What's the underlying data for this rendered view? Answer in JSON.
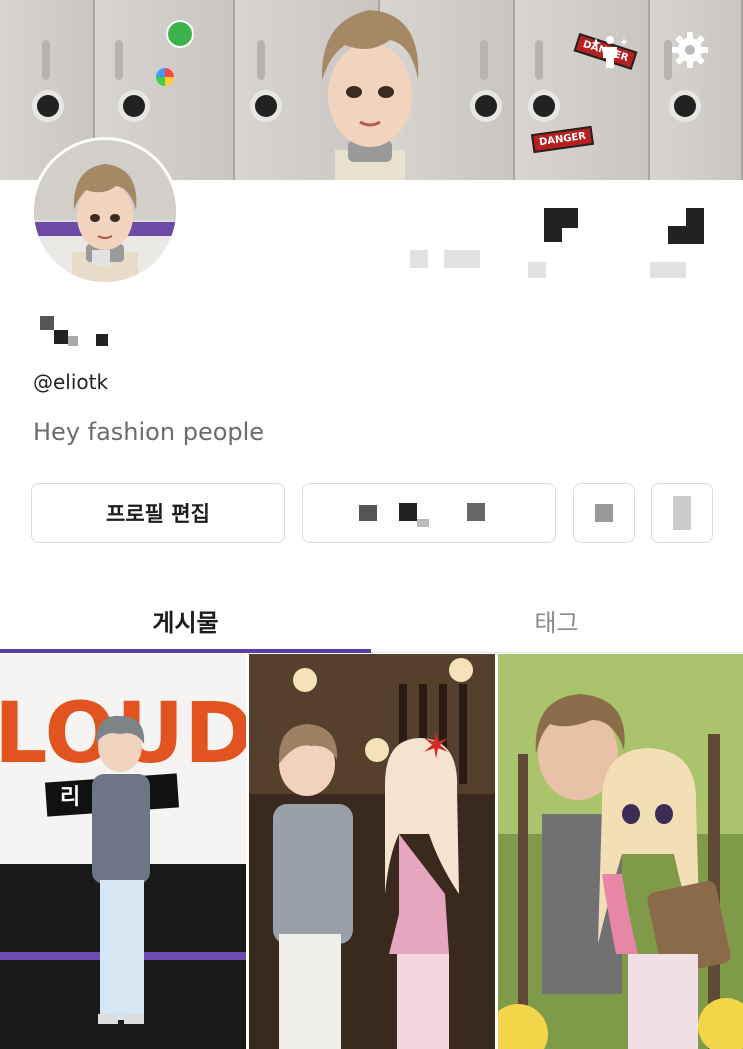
{
  "header": {
    "banner_sticker_text": "DANGER",
    "actions": [
      {
        "name": "avatar-style",
        "icon": "sparkle-person-icon"
      },
      {
        "name": "settings",
        "icon": "gear-icon"
      }
    ]
  },
  "profile": {
    "username": "@eliotk",
    "bio": "Hey fashion people"
  },
  "buttons": {
    "edit_profile": "프로필 편집"
  },
  "tabs": [
    {
      "label": "게시물",
      "active": true
    },
    {
      "label": "태그",
      "active": false
    }
  ],
  "colors": {
    "accent": "#5b3ea5",
    "bio_text": "#6b6b6b",
    "loud_orange": "#e2541f"
  },
  "posts": [
    {
      "index": 0,
      "caption_text": "LOUD",
      "sub_text": "리"
    },
    {
      "index": 1
    },
    {
      "index": 2
    }
  ]
}
